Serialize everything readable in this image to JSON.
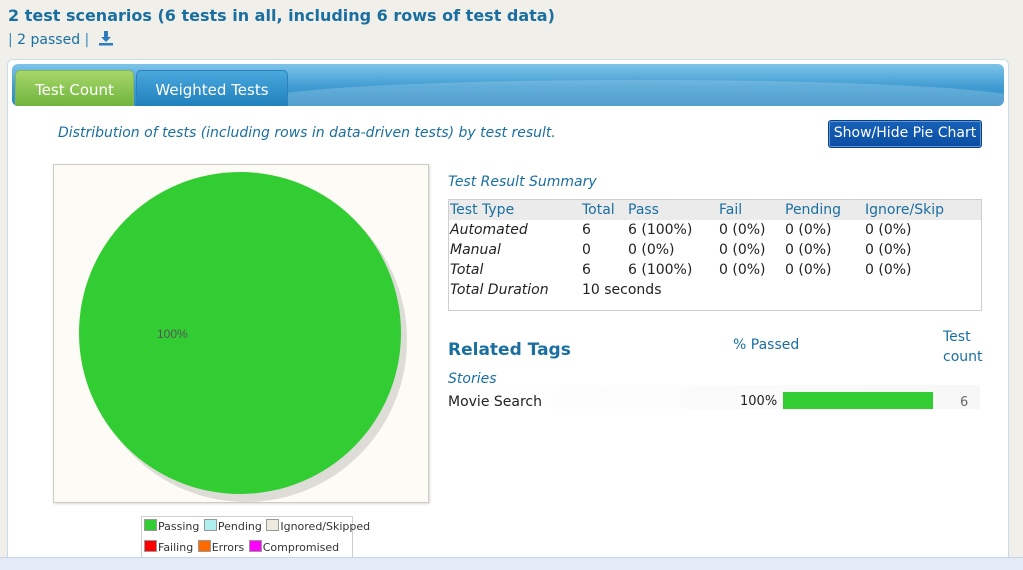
{
  "header": {
    "title": "2 test scenarios (6 tests in all, including 6 rows of test data)",
    "separator": "|",
    "passed_link": "2 passed",
    "download_icon": "download-icon"
  },
  "tabs": [
    {
      "label": "Test Count",
      "active": true
    },
    {
      "label": "Weighted Tests",
      "active": false
    }
  ],
  "distribution_text": "Distribution of tests (including rows in data-driven tests) by test result.",
  "toggle_button": "Show/Hide Pie Chart",
  "pie": {
    "slice_label": "100%",
    "colors": {
      "passing": "#32cd32"
    }
  },
  "legend": [
    {
      "label": "Passing",
      "color": "#32cd32"
    },
    {
      "label": "Pending",
      "color": "#aeeeee"
    },
    {
      "label": "Ignored/Skipped",
      "color": "#eeeadd"
    },
    {
      "label": "Failing",
      "color": "#ff0000"
    },
    {
      "label": "Errors",
      "color": "#ff6a00"
    },
    {
      "label": "Compromised",
      "color": "#ff00ff"
    }
  ],
  "result_summary": {
    "title": "Test Result Summary",
    "headers": [
      "Test Type",
      "Total",
      "Pass",
      "Fail",
      "Pending",
      "Ignore/Skip"
    ],
    "rows": [
      [
        "Automated",
        "6",
        "6 (100%)",
        "0 (0%)",
        "0 (0%)",
        "0 (0%)"
      ],
      [
        "Manual",
        "0",
        "0 (0%)",
        "0 (0%)",
        "0 (0%)",
        "0 (0%)"
      ],
      [
        "Total",
        "6",
        "6 (100%)",
        "0 (0%)",
        "0 (0%)",
        "0 (0%)"
      ]
    ],
    "duration_label": "Total Duration",
    "duration_value": "10 seconds"
  },
  "related_tags": {
    "title": "Related Tags",
    "passed_header": "% Passed",
    "count_header": "Test count",
    "group": "Stories",
    "items": [
      {
        "name": "Movie Search",
        "percent_label": "100%",
        "percent": 100,
        "count": "6"
      }
    ]
  }
}
